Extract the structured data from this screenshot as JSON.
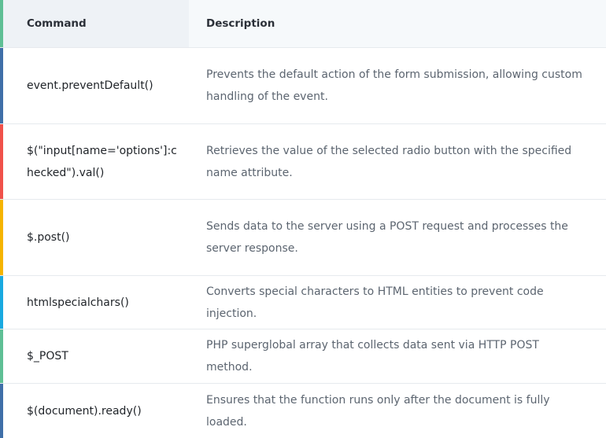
{
  "header": {
    "command": "Command",
    "description": "Description"
  },
  "colors": {
    "header_bar": "#5fbf95",
    "bars": [
      "#3f6fa8",
      "#f0514a",
      "#f5b400",
      "#19a9e0",
      "#5fbf95",
      "#3f6fa8"
    ]
  },
  "rows": [
    {
      "command": "event.preventDefault()",
      "description": "Prevents the default action of the form submission, allowing custom handling of the event."
    },
    {
      "command": "$(\"input[name='options']:checked\").val()",
      "description": "Retrieves the value of the selected radio button with the specified name attribute."
    },
    {
      "command": "$.post()",
      "description": "Sends data to the server using a POST request and processes the server response."
    },
    {
      "command": "htmlspecialchars()",
      "description": "Converts special characters to HTML entities to prevent code injection."
    },
    {
      "command": "$_POST",
      "description": "PHP superglobal array that collects data sent via HTTP POST method."
    },
    {
      "command": "$(document).ready()",
      "description": "Ensures that the function runs only after the document is fully loaded."
    }
  ]
}
